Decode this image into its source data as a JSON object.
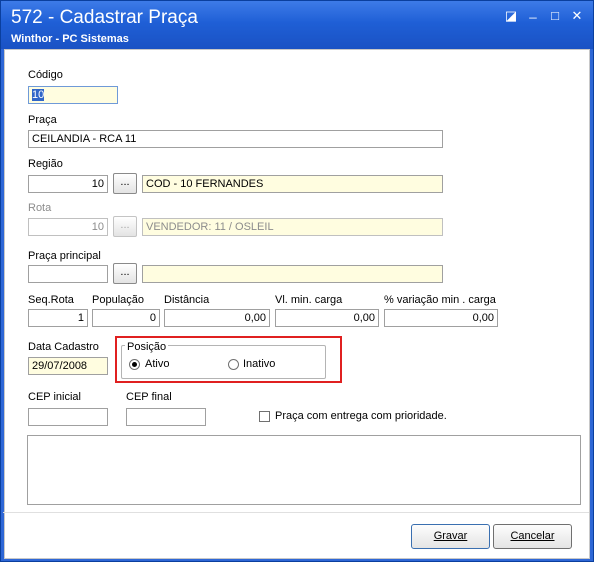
{
  "window": {
    "title": "572 - Cadastrar Praça",
    "subtitle": "Winthor - PC Sistemas",
    "controls": {
      "restore": "◪",
      "minimize": "_",
      "maximize": "□",
      "close": "✕"
    }
  },
  "form": {
    "codigo": {
      "label": "Código",
      "value": "10"
    },
    "praca": {
      "label": "Praça",
      "value": "CEILANDIA - RCA 11"
    },
    "regiao": {
      "label": "Região",
      "code": "10",
      "button": "...",
      "description": "COD - 10 FERNANDES"
    },
    "rota": {
      "label": "Rota",
      "code": "10",
      "button": "...",
      "description": "VENDEDOR: 11 / OSLEIL"
    },
    "praca_principal": {
      "label": "Praça principal",
      "code": "",
      "button": "...",
      "description": ""
    },
    "seq_rota": {
      "label": "Seq.Rota",
      "value": "1"
    },
    "populacao": {
      "label": "População",
      "value": "0"
    },
    "distancia": {
      "label": "Distância",
      "value": "0,00"
    },
    "vl_min_carga": {
      "label": "Vl. min. carga",
      "value": "0,00"
    },
    "variacao_min_carga": {
      "label": "% variação min . carga",
      "value": "0,00"
    },
    "data_cadastro": {
      "label": "Data Cadastro",
      "value": "29/07/2008"
    },
    "posicao": {
      "label": "Posição",
      "options": [
        "Ativo",
        "Inativo"
      ],
      "selected": "Ativo"
    },
    "cep_inicial": {
      "label": "CEP inicial",
      "value": ""
    },
    "cep_final": {
      "label": "CEP final",
      "value": ""
    },
    "entrega_prioridade": {
      "label": "Praça com entrega com prioridade.",
      "checked": false
    },
    "observacao": {
      "value": ""
    }
  },
  "buttons": {
    "save": "Gravar",
    "cancel": "Cancelar"
  },
  "colors": {
    "titlebar": "#1f5fd6",
    "highlight": "#e02020",
    "field_yellow": "#fffde0"
  }
}
